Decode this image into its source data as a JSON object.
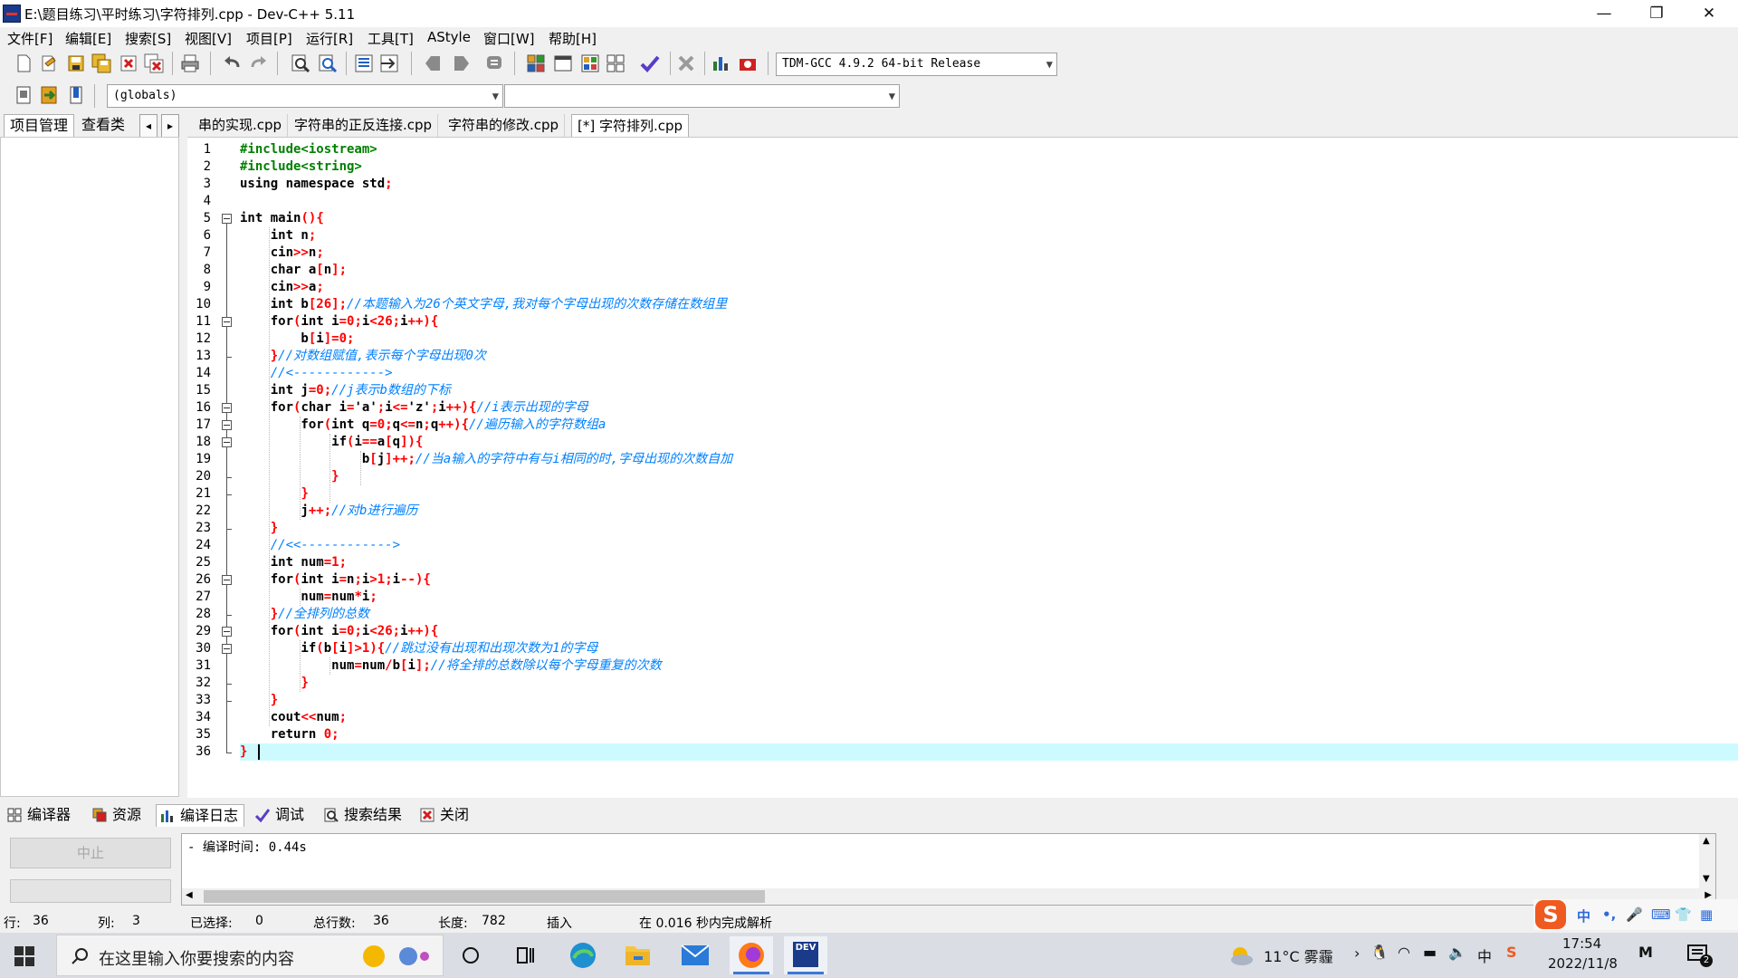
{
  "window": {
    "title": "E:\\题目练习\\平时练习\\字符排列.cpp - Dev-C++ 5.11",
    "minimize": "—",
    "restore": "❐",
    "close": "✕"
  },
  "menu": [
    "文件[F]",
    "编辑[E]",
    "搜索[S]",
    "视图[V]",
    "项目[P]",
    "运行[R]",
    "工具[T]",
    "AStyle",
    "窗口[W]",
    "帮助[H]"
  ],
  "toolbar": {
    "compiler_select": "TDM-GCC 4.9.2 64-bit Release",
    "scope_select": "(globals)",
    "member_select": ""
  },
  "left_tabs": {
    "project": "项目管理",
    "classes": "查看类",
    "prev": "◂",
    "next": "▸"
  },
  "file_tabs": [
    "串的实现.cpp",
    "字符串的正反连接.cpp",
    "字符串的修改.cpp",
    "[*] 字符排列.cpp"
  ],
  "code_lines": [
    "#include<iostream>",
    "#include<string>",
    "using namespace std;",
    "",
    "int main(){",
    "    int n;",
    "    cin>>n;",
    "    char a[n];",
    "    cin>>a;",
    "    int b[26];//本题输入为26个英文字母,我对每个字母出现的次数存储在数组里",
    "    for(int i=0;i<26;i++){",
    "        b[i]=0;",
    "    }//对数组赋值,表示每个字母出现0次",
    "    //<------------>",
    "    int j=0;//j表示b数组的下标",
    "    for(char i='a';i<='z';i++){//i表示出现的字母",
    "        for(int q=0;q<=n;q++){//遍历输入的字符数组a",
    "            if(i==a[q]){",
    "                b[j]++;//当a输入的字符中有与i相同的时,字母出现的次数自加",
    "            }",
    "        }",
    "        j++;//对b进行遍历",
    "    }",
    "    //<<------------>",
    "    int num=1;",
    "    for(int i=n;i>1;i--){",
    "        num=num*i;",
    "    }//全排列的总数",
    "    for(int i=0;i<26;i++){",
    "        if(b[i]>1){//跳过没有出现和出现次数为1的字母",
    "            num=num/b[i];//将全排的总数除以每个字母重复的次数",
    "        }",
    "    }",
    "    cout<<num;",
    "    return 0;",
    "}"
  ],
  "bottom_tabs": [
    "编译器",
    "资源",
    "编译日志",
    "调试",
    "搜索结果",
    "关闭"
  ],
  "bottom": {
    "stop_button": "中止",
    "log_text": "- 编译时间: 0.44s"
  },
  "status": {
    "row_label": "行:",
    "row": "36",
    "col_label": "列:",
    "col": "3",
    "sel_label": "已选择:",
    "sel": "0",
    "lines_label": "总行数:",
    "lines": "36",
    "len_label": "长度:",
    "len": "782",
    "mode": "插入",
    "parse": "在 0.016 秒内完成解析"
  },
  "ime": {
    "logo": "S",
    "lang": "中"
  },
  "taskbar": {
    "search_placeholder": "在这里输入你要搜索的内容",
    "weather": "11°C  雾霾",
    "ime_lang": "中",
    "time": "17:54",
    "date": "2022/11/8",
    "notif_count": "2",
    "dev_label": "DEV"
  },
  "colors": {
    "preprocessor": "#008000",
    "symbol": "#ff0000",
    "comment": "#0080ff",
    "current_line": "#ccfaff",
    "accent": "#3b78d8"
  }
}
